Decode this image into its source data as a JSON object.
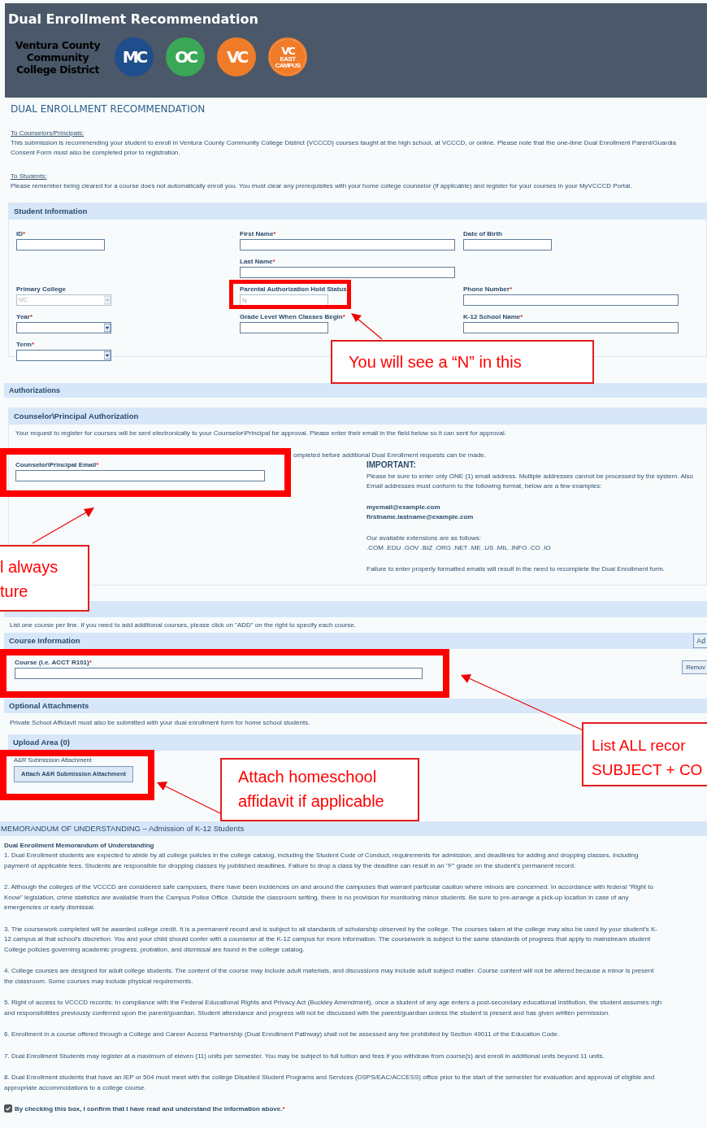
{
  "header": {
    "title": "Dual Enrollment Recommendation",
    "district": [
      "Ventura County",
      "Community",
      "College District"
    ],
    "logos": [
      {
        "text": "MC",
        "kind": "solid",
        "color": "#1f4e8c"
      },
      {
        "text": "OC",
        "kind": "solid",
        "color": "#3aa856"
      },
      {
        "text": "VC",
        "kind": "solid",
        "color": "#f07c2a"
      },
      {
        "text": "VC",
        "subtext": "EAST CAMPUS",
        "kind": "ringed",
        "color": "#f07c2a"
      }
    ]
  },
  "page_heading": "DUAL ENROLLMENT RECOMMENDATION",
  "notices": [
    {
      "heading": "To Counselors/Principals:",
      "lines": [
        "This submission is recommending your student to enroll in Ventura County Community College District (VCCCD) courses taught at the high school, at VCCCD, or online. Please note that the one-time Dual Enrollment Parent/Guardia",
        "Consent Form must also be completed prior to registration."
      ]
    },
    {
      "heading": "To Students:",
      "lines": [
        "Please remember being cleared for a course does not automatically enroll you. You must clear any prerequisites with your home college counselor (if applicable) and register for your courses in your MyVCCCD Portal."
      ]
    }
  ],
  "student_information": {
    "title": "Student Information",
    "rows": [
      [
        {
          "label": "ID",
          "mark": "*",
          "kind": "short",
          "disabled": false
        },
        {
          "label": "First Name",
          "mark": "*",
          "kind": "long",
          "disabled": false
        },
        {
          "label": "Date of Birth",
          "kind": "short",
          "disabled": false
        }
      ],
      [
        null,
        {
          "label": "Last Name",
          "mark": "*",
          "kind": "long",
          "disabled": false
        },
        null
      ],
      [
        {
          "label": "Primary College",
          "kind": "select",
          "value": "VC",
          "disabled": true
        },
        {
          "label": "Parental Authorization Hold Status",
          "kind": "short",
          "value": "N",
          "disabled": true
        },
        {
          "label": "Phone Number",
          "mark": "*",
          "kind": "long",
          "disabled": false
        }
      ],
      [
        {
          "label": "Year",
          "mark": "*",
          "kind": "select",
          "disabled": false
        },
        {
          "label": "Grade Level When Classes Begin",
          "mark": "*",
          "kind": "short",
          "disabled": false
        },
        {
          "label": "K-12 School Name",
          "mark": "*",
          "kind": "long",
          "disabled": false
        }
      ],
      [
        {
          "label": "Term",
          "mark": "*",
          "kind": "select",
          "disabled": false
        },
        null,
        null
      ]
    ]
  },
  "authorizations": {
    "title": "Authorizations",
    "panel_title": "Counselor\\Principal Authorization",
    "intro": "Your request to register for courses will be sent electronically to your Counselor\\Principal for approval. Please enter their email in the field below so it can sent for approval.",
    "note": "ompleted before additional Dual Enrollment requests can be made.",
    "email_field": {
      "label": "Counselor\\Principal Email",
      "mark": "*"
    },
    "important": {
      "heading": "IMPORTANT:",
      "lines": [
        "Please be sure to enter only ONE (1) email address. Multiple addresses cannot be processed by the system. Also",
        "Email addresses must conform to the following format, below are a few examples:"
      ],
      "examples": [
        "myemail@example.com",
        "firstname.lastname@example.com"
      ],
      "extensions": [
        "Our available extensions are as follows:",
        ".COM .EDU .GOV .BIZ .ORG .NET .ME .US .MIL .INFO .CO .IO"
      ],
      "warning": "Failure to enter properly formatted emails will result in the need to recomplete the Dual Enrollment form."
    }
  },
  "courses": {
    "instruction": "List one course per line. If you need to add additional courses, please click on \"ADD\" on the right to specify each course.",
    "title": "Course Information",
    "add_button": "Ad",
    "field": {
      "label": "Course (i.e. ACCT R101)",
      "mark": "*"
    },
    "remove_button": "Remov"
  },
  "attachments": {
    "title": "Optional Attachments",
    "text": "Private School Affidavit must also be submitted with your dual enrollment form for home school students.",
    "upload_area": "Upload Area (0)",
    "attachment_label": "A&R Submission Attachment",
    "attach_button": "Attach A&R Submission Attachment"
  },
  "memorandum": {
    "title": "MEMORANDUM OF UNDERSTANDING – Admission of K-12 Students",
    "subtitle": "Dual Enrollment Memorandum of Understanding",
    "paragraphs": [
      [
        "1. Dual Enrollment students are expected to abide by all college policies in the college catalog, including the Student Code of Conduct, requirements for admission, and deadlines for adding and dropping classes, including",
        "payment of applicable fees. Students are responsible for dropping classes by published deadlines. Failure to drop a class by the deadline can result in an \"F\" grade on the student's permanent record."
      ],
      [
        "2. Although the colleges of the VCCCD are considered safe campuses, there have been incidences on and around the campuses that warrant particular caution where minors are concerned. In accordance with federal \"Right to",
        "Know\" legislation, crime statistics are available from the Campus Police Office. Outside the classroom setting, there is no provision for monitoring minor students. Be sure to pre-arrange a pick-up location in case of any",
        "emergencies or early dismissal."
      ],
      [
        "3. The coursework completed will be awarded college credit. It is a permanent record and is subject to all standards of scholarship observed by the college. The courses taken at the college may also be used by your student's K-",
        "12 campus at that school's discretion. You and your child should confer with a counselor at the K-12 campus for more information. The coursework is subject to the same standards of progress that apply to mainstream student",
        "College policies governing academic progress, probation, and dismissal are found in the college catalog."
      ],
      [
        "4. College courses are designed for adult college students. The content of the course may include adult materials, and discussions may include adult subject matter. Course content will not be altered because a minor is present",
        "the classroom. Some courses may include physical requirements."
      ],
      [
        "5. Right of access to VCCCD records: In compliance with the Federal Educational Rights and Privacy Act (Buckley Amendment), once a student of any age enters a post-secondary educational institution, the student assumes righ",
        "and responsibilities previously conferred upon the parent/guardian. Student attendance and progress will not be discussed with the parent/guardian unless the student is present and has given written permission."
      ],
      [
        "6. Enrollment in a course offered through a College and Career Access Partnership (Dual Enrollment Pathway) shall not be assessed any fee prohibited by Section 49011 of the Education Code."
      ],
      [
        "7. Dual Enrollment Students may register at a maximum of eleven (11) units per semester. You may be subject to full tuition and fees if you withdraw from course(s) and enroll in additional units beyond 11 units."
      ],
      [
        "8. Dual Enrollment students that have an IEP or 504 must meet with the college Disabled Student Programs and Services (DSPS/EAC/ACCESS) office prior to the start of the semester for evaluation and approval of eligible and",
        "appropriate accommodations to a college course."
      ]
    ],
    "confirmation": {
      "label": "By checking this box, I confirm that I have read and understand the information above.",
      "mark": "*",
      "checked": true
    }
  },
  "callouts": [
    {
      "lines": [
        "You will see a “N” in this"
      ]
    },
    {
      "lines": [
        "l always",
        "ture"
      ]
    },
    {
      "lines": [
        "List ALL recor",
        "SUBJECT + CO"
      ]
    },
    {
      "lines": [
        "Attach homeschool",
        "affidavit if applicable"
      ]
    }
  ]
}
